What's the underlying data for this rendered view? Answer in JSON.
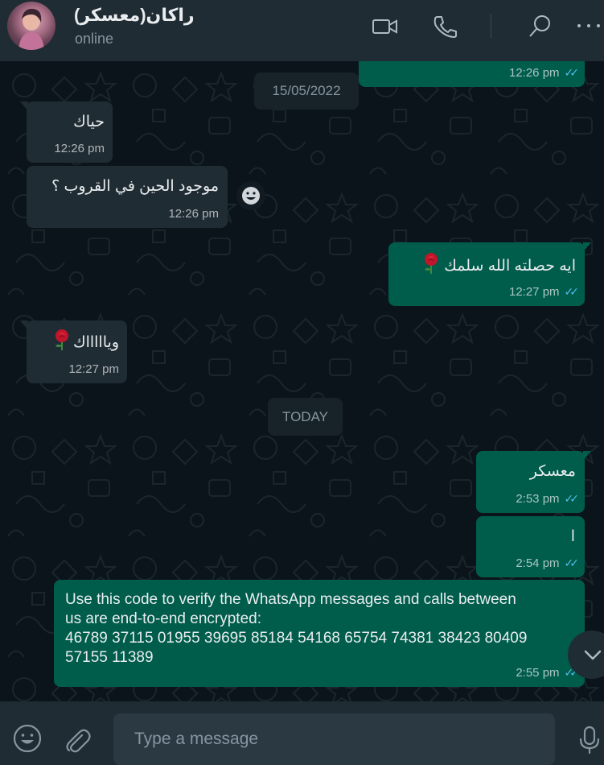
{
  "header": {
    "contact_name": "راكان(معسكر)",
    "status": "online",
    "icons": [
      "video-call-icon",
      "voice-call-icon",
      "search-icon",
      "menu-icon"
    ]
  },
  "dates": {
    "first": "15/05/2022",
    "second": "TODAY"
  },
  "messages": [
    {
      "dir": "out",
      "text": "",
      "time": "12:26 pm",
      "ticks": "read"
    },
    {
      "dir": "in",
      "text": "حياك",
      "time": "12:26 pm"
    },
    {
      "dir": "in",
      "text": "موجود الحين في القروب ؟",
      "time": "12:26 pm"
    },
    {
      "dir": "out",
      "text": "ايه حصلته الله سلمك",
      "emoji": "rose",
      "time": "12:27 pm",
      "ticks": "read"
    },
    {
      "dir": "in",
      "text": "وياااااك",
      "emoji": "rose",
      "time": "12:27 pm"
    },
    {
      "dir": "out",
      "text": "معسكر",
      "time": "2:53 pm",
      "ticks": "read"
    },
    {
      "dir": "out",
      "text": "ا",
      "time": "2:54 pm",
      "ticks": "read"
    },
    {
      "dir": "out",
      "text": "Use this code to verify the WhatsApp messages and calls between us are end-to-end encrypted:",
      "code_line1": "46789 37115 01955 39695 85184 54168 65754 74381 38423 80409",
      "code_line2": "57155 11389",
      "time": "2:55 pm",
      "ticks": "read"
    }
  ],
  "encryption": {
    "line1": "Use this code to verify the WhatsApp messages and calls between",
    "line2": "us are end-to-end encrypted:"
  },
  "footer": {
    "placeholder": "Type a message",
    "icons": [
      "emoji-icon",
      "attach-icon",
      "microphone-icon"
    ]
  },
  "colors": {
    "header_bg": "#202c33",
    "chat_bg": "#0b141a",
    "incoming_bubble": "#202c33",
    "outgoing_bubble": "#005c4b",
    "read_ticks": "#53bdeb"
  }
}
